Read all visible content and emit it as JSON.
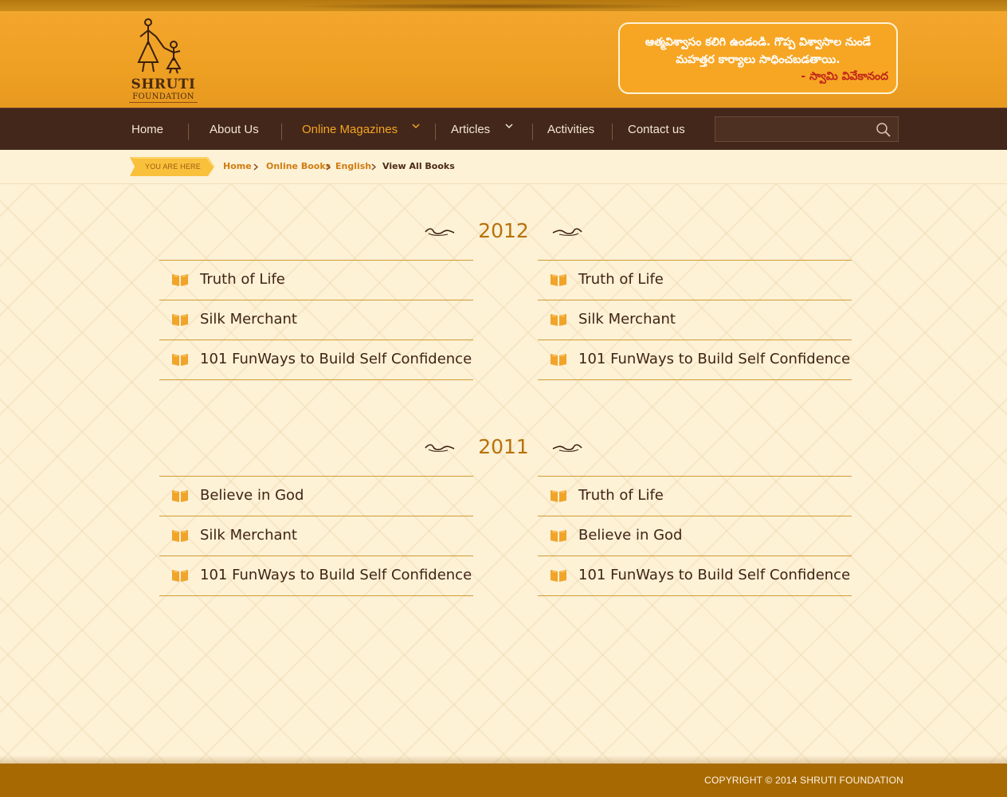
{
  "header": {
    "logo": {
      "title": "SHRUTI",
      "subtitle": "FOUNDATION"
    },
    "quote": {
      "text": "ఆత్మవిశ్వాసం కలిగి ఉండండి. గొప్ప విశ్వాసాల నుండే మహత్తర కార్యాలు సాధించబడతాయి.",
      "author": "- స్వామి వివేకానంద"
    }
  },
  "nav": {
    "items": [
      {
        "label": "Home"
      },
      {
        "label": "About Us"
      },
      {
        "label": "Online Magazines"
      },
      {
        "label": "Articles"
      },
      {
        "label": "Activities"
      },
      {
        "label": "Contact us"
      }
    ],
    "active_item": "Online Magazines",
    "search": {
      "placeholder": "",
      "icon": "search-icon"
    }
  },
  "breadcrumb": {
    "badge": "YOU ARE HERE",
    "items": [
      "Home",
      "Online Books",
      "English",
      "View All Books"
    ]
  },
  "sections": [
    {
      "year": "2012",
      "left": [
        "Truth of Life",
        "Silk Merchant",
        "101 FunWays to Build Self Confidence"
      ],
      "right": [
        "Truth of Life",
        "Silk Merchant",
        "101 FunWays to Build Self Confidence"
      ]
    },
    {
      "year": "2011",
      "left": [
        "Believe in God",
        "Silk Merchant",
        "101 FunWays to Build Self Confidence"
      ],
      "right": [
        "Truth of Life",
        "Believe in God",
        "101 FunWays to Build Self Confidence"
      ]
    }
  ],
  "footer": {
    "copyright": "COPYRIGHT © 2014 SHRUTI FOUNDATION"
  },
  "colors": {
    "accent": "#f5a423",
    "nav_bg": "#43271a",
    "footer_bg": "#a76a03",
    "header_bg": "#f0a127"
  }
}
